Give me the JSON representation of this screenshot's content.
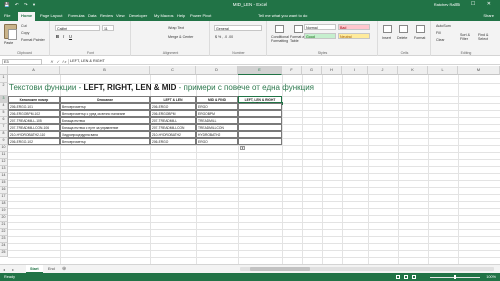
{
  "window": {
    "title": "MID_LEN - Excel",
    "user": "Ratchev Radio",
    "quick_access": "💾 ↶ ↷ ▾",
    "controls": "— ☐ ✕"
  },
  "tabs": [
    "File",
    "Home",
    "Page Layout",
    "Formulas",
    "Data",
    "Review",
    "View",
    "Developer",
    "My Macros",
    "Help",
    "Power Pivot"
  ],
  "active_tab": "Home",
  "tell_me": "Tell me what you want to do",
  "share": "Share",
  "ribbon": {
    "clipboard": {
      "label": "Clipboard",
      "paste": "Paste",
      "cut": "Cut",
      "copy": "Copy",
      "format_painter": "Format Painter"
    },
    "font": {
      "label": "Font",
      "name": "Calibri",
      "size": "11",
      "bold": "B",
      "italic": "I",
      "underline": "U"
    },
    "alignment": {
      "label": "Alignment",
      "wrap": "Wrap Text",
      "merge": "Merge & Center"
    },
    "number": {
      "label": "Number",
      "format": "General",
      "symbols": "$ % ,   .0 .00"
    },
    "styles": {
      "label": "Styles",
      "conditional": "Conditional Formatting",
      "format_table": "Format as Table",
      "normal": "Normal",
      "bad": "Bad",
      "good": "Good",
      "neutral": "Neutral"
    },
    "cells": {
      "label": "Cells",
      "insert": "Insert",
      "delete": "Delete",
      "format": "Format"
    },
    "editing": {
      "label": "Editing",
      "autosum": "AutoSum",
      "fill": "Fill",
      "clear": "Clear",
      "sort": "Sort & Filter",
      "find": "Find & Select"
    }
  },
  "formula_bar": {
    "name_box": "E3",
    "fx": "✕ ✓ fx",
    "value": "LEFT, LEN & RIGHT"
  },
  "columns": [
    "A",
    "B",
    "C",
    "D",
    "E",
    "F",
    "G",
    "H",
    "I",
    "J",
    "K",
    "L",
    "M"
  ],
  "selected_column": "E",
  "rows": [
    "1",
    "2",
    "3",
    "4",
    "5",
    "6",
    "7",
    "8",
    "9",
    "10",
    "11",
    "12",
    "13",
    "14",
    "15",
    "16",
    "17",
    "18",
    "19",
    "20",
    "21",
    "22",
    "23",
    "24",
    "25"
  ],
  "selected_row": "3",
  "sheet_title": {
    "part1": "Текстови функции - ",
    "part2": "LEFT, RIGHT, LEN & MID",
    "part3": " - примери с повече от една функция"
  },
  "table": {
    "headers": [
      "Каталожен номер",
      "Описание",
      "LEFT & LEN",
      "MID & FIND",
      "LEFT, LEN & RIGHT"
    ],
    "rows": [
      [
        "206-ERGO-101",
        "Велоергометър",
        "206-ERGO",
        "ERGO",
        ""
      ],
      [
        "206-ERGOBPM-102",
        "Велоергометър с уред за вечно налягане",
        "206-ERGOBPM",
        "ERGOBPM",
        ""
      ],
      [
        "207-TREADMILL-105",
        "Бягаща пътека",
        "207-TREADMILL",
        "TREADMILL",
        ""
      ],
      [
        "207-TREADMILLCON-106",
        "Бягаща пътека с пулт за управление",
        "207-TREADMILLCON",
        "TREADMILLCON",
        ""
      ],
      [
        "210-HYDROBATH2-110",
        "Хидропроцедурна вана",
        "210-HYDROBATH2",
        "HYDROBATH2",
        ""
      ],
      [
        "206-ERGO-102",
        "Велоергометър",
        "206-ERGO",
        "ERGO",
        ""
      ]
    ]
  },
  "sheets": [
    "Start",
    "End"
  ],
  "active_sheet": "Start",
  "status": {
    "text": "Ready",
    "zoom": "100%"
  }
}
